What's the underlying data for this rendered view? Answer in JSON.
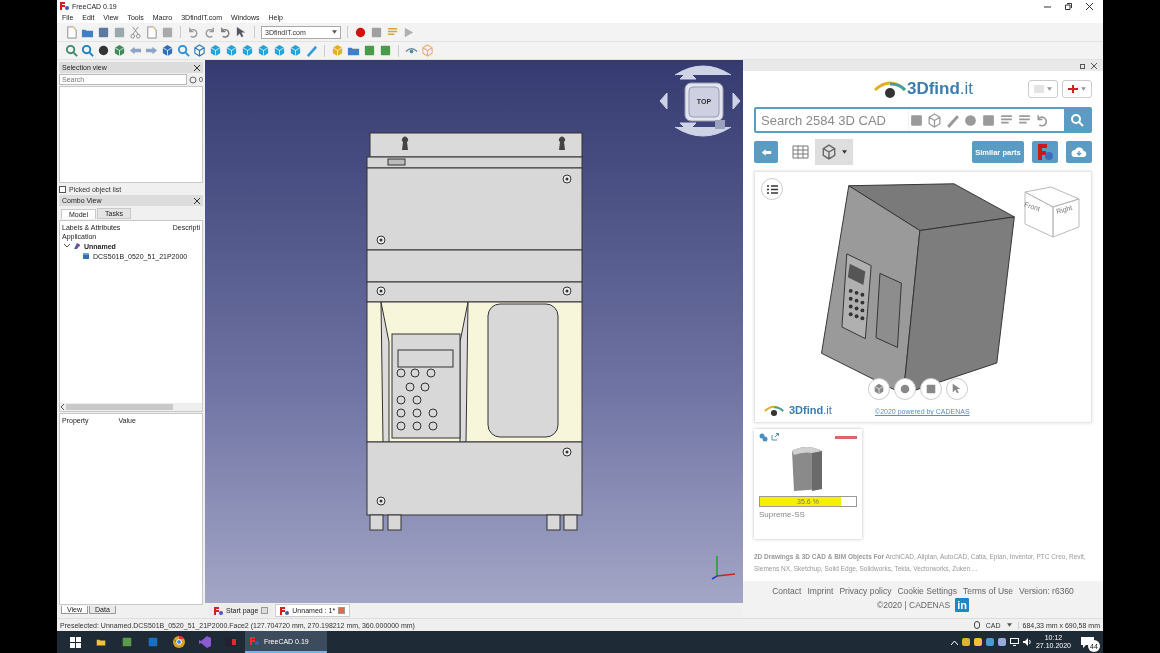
{
  "window": {
    "title": "FreeCAD 0.19"
  },
  "menu": [
    "File",
    "Edit",
    "View",
    "Tools",
    "Macro",
    "3DfindIT.com",
    "Windows",
    "Help"
  ],
  "toolbar": {
    "workbench": "3DfindIT.com"
  },
  "selection_view": {
    "title": "Selection view",
    "search": {
      "placeholder": "Search"
    },
    "count": "0",
    "picked_list": {
      "label": "Picked object list",
      "checked": false
    }
  },
  "combo_view": {
    "title": "Combo View",
    "tabs": [
      {
        "label": "Model",
        "selected": true
      },
      {
        "label": "Tasks",
        "selected": false
      }
    ],
    "columns": [
      "Labels & Attributes",
      "Descripti"
    ],
    "root_label": "Application",
    "tree": [
      {
        "label": "Unnamed",
        "expanded": true,
        "children": [
          {
            "label": "DCS501B_0520_51_21P2000"
          }
        ]
      }
    ],
    "property_columns": [
      "Property",
      "Value"
    ],
    "bottom_tabs": [
      {
        "label": "View",
        "selected": true
      },
      {
        "label": "Data",
        "selected": false
      }
    ]
  },
  "viewport": {
    "cube_face": "TOP"
  },
  "document_tabs": [
    {
      "label": "Start page",
      "selected": false
    },
    {
      "label": "Unnamed : 1*",
      "selected": true
    }
  ],
  "finder": {
    "logo": "**3Dfind**.it",
    "search": {
      "placeholder": "Search 2584 3D CAD"
    },
    "view_tabs": [
      {
        "kind": "table",
        "selected": false
      },
      {
        "kind": "model",
        "selected": true
      }
    ],
    "similar_button": "Similar parts",
    "viewer": {
      "cube_faces": [
        "Front",
        "Right"
      ],
      "logo": "**3Dfind**.it",
      "credit": "©2020 powered by CADENAS"
    },
    "results": [
      {
        "match": "35.6 %",
        "level": 0.84,
        "name": "Supreme-SS"
      }
    ],
    "formats": "**2D Drawings & 3D CAD & BIM Objects For** ArchiCAD, Allplan, AutoCAD, Catia, Eplan, Inventor, PTC Creo, Revit, Siemens NX, Sketchup, Solid Edge, Solidworks, Tekla, Vectorworks, Zuken ...",
    "footer_links": [
      "Contact",
      "Imprint",
      "Privacy policy",
      "Cookie Settings",
      "Terms of Use",
      "Version: r6360"
    ],
    "copyright": "©2020 | CADENAS",
    "social": "in"
  },
  "status_bar": {
    "message": "Preselected: Unnamed.DCS501B_0520_51_21P2000.Face2 (127.704720 mm, 270.198212 mm, 360.000000 mm)",
    "units": "CAD",
    "dimensions": "684,33 mm x 690,58 mm"
  },
  "taskbar": {
    "apps": [
      {
        "label": "FreeCAD 0.19",
        "selected": true
      }
    ],
    "time": "10:12",
    "date": "27.10.2020",
    "notifications": "44"
  }
}
